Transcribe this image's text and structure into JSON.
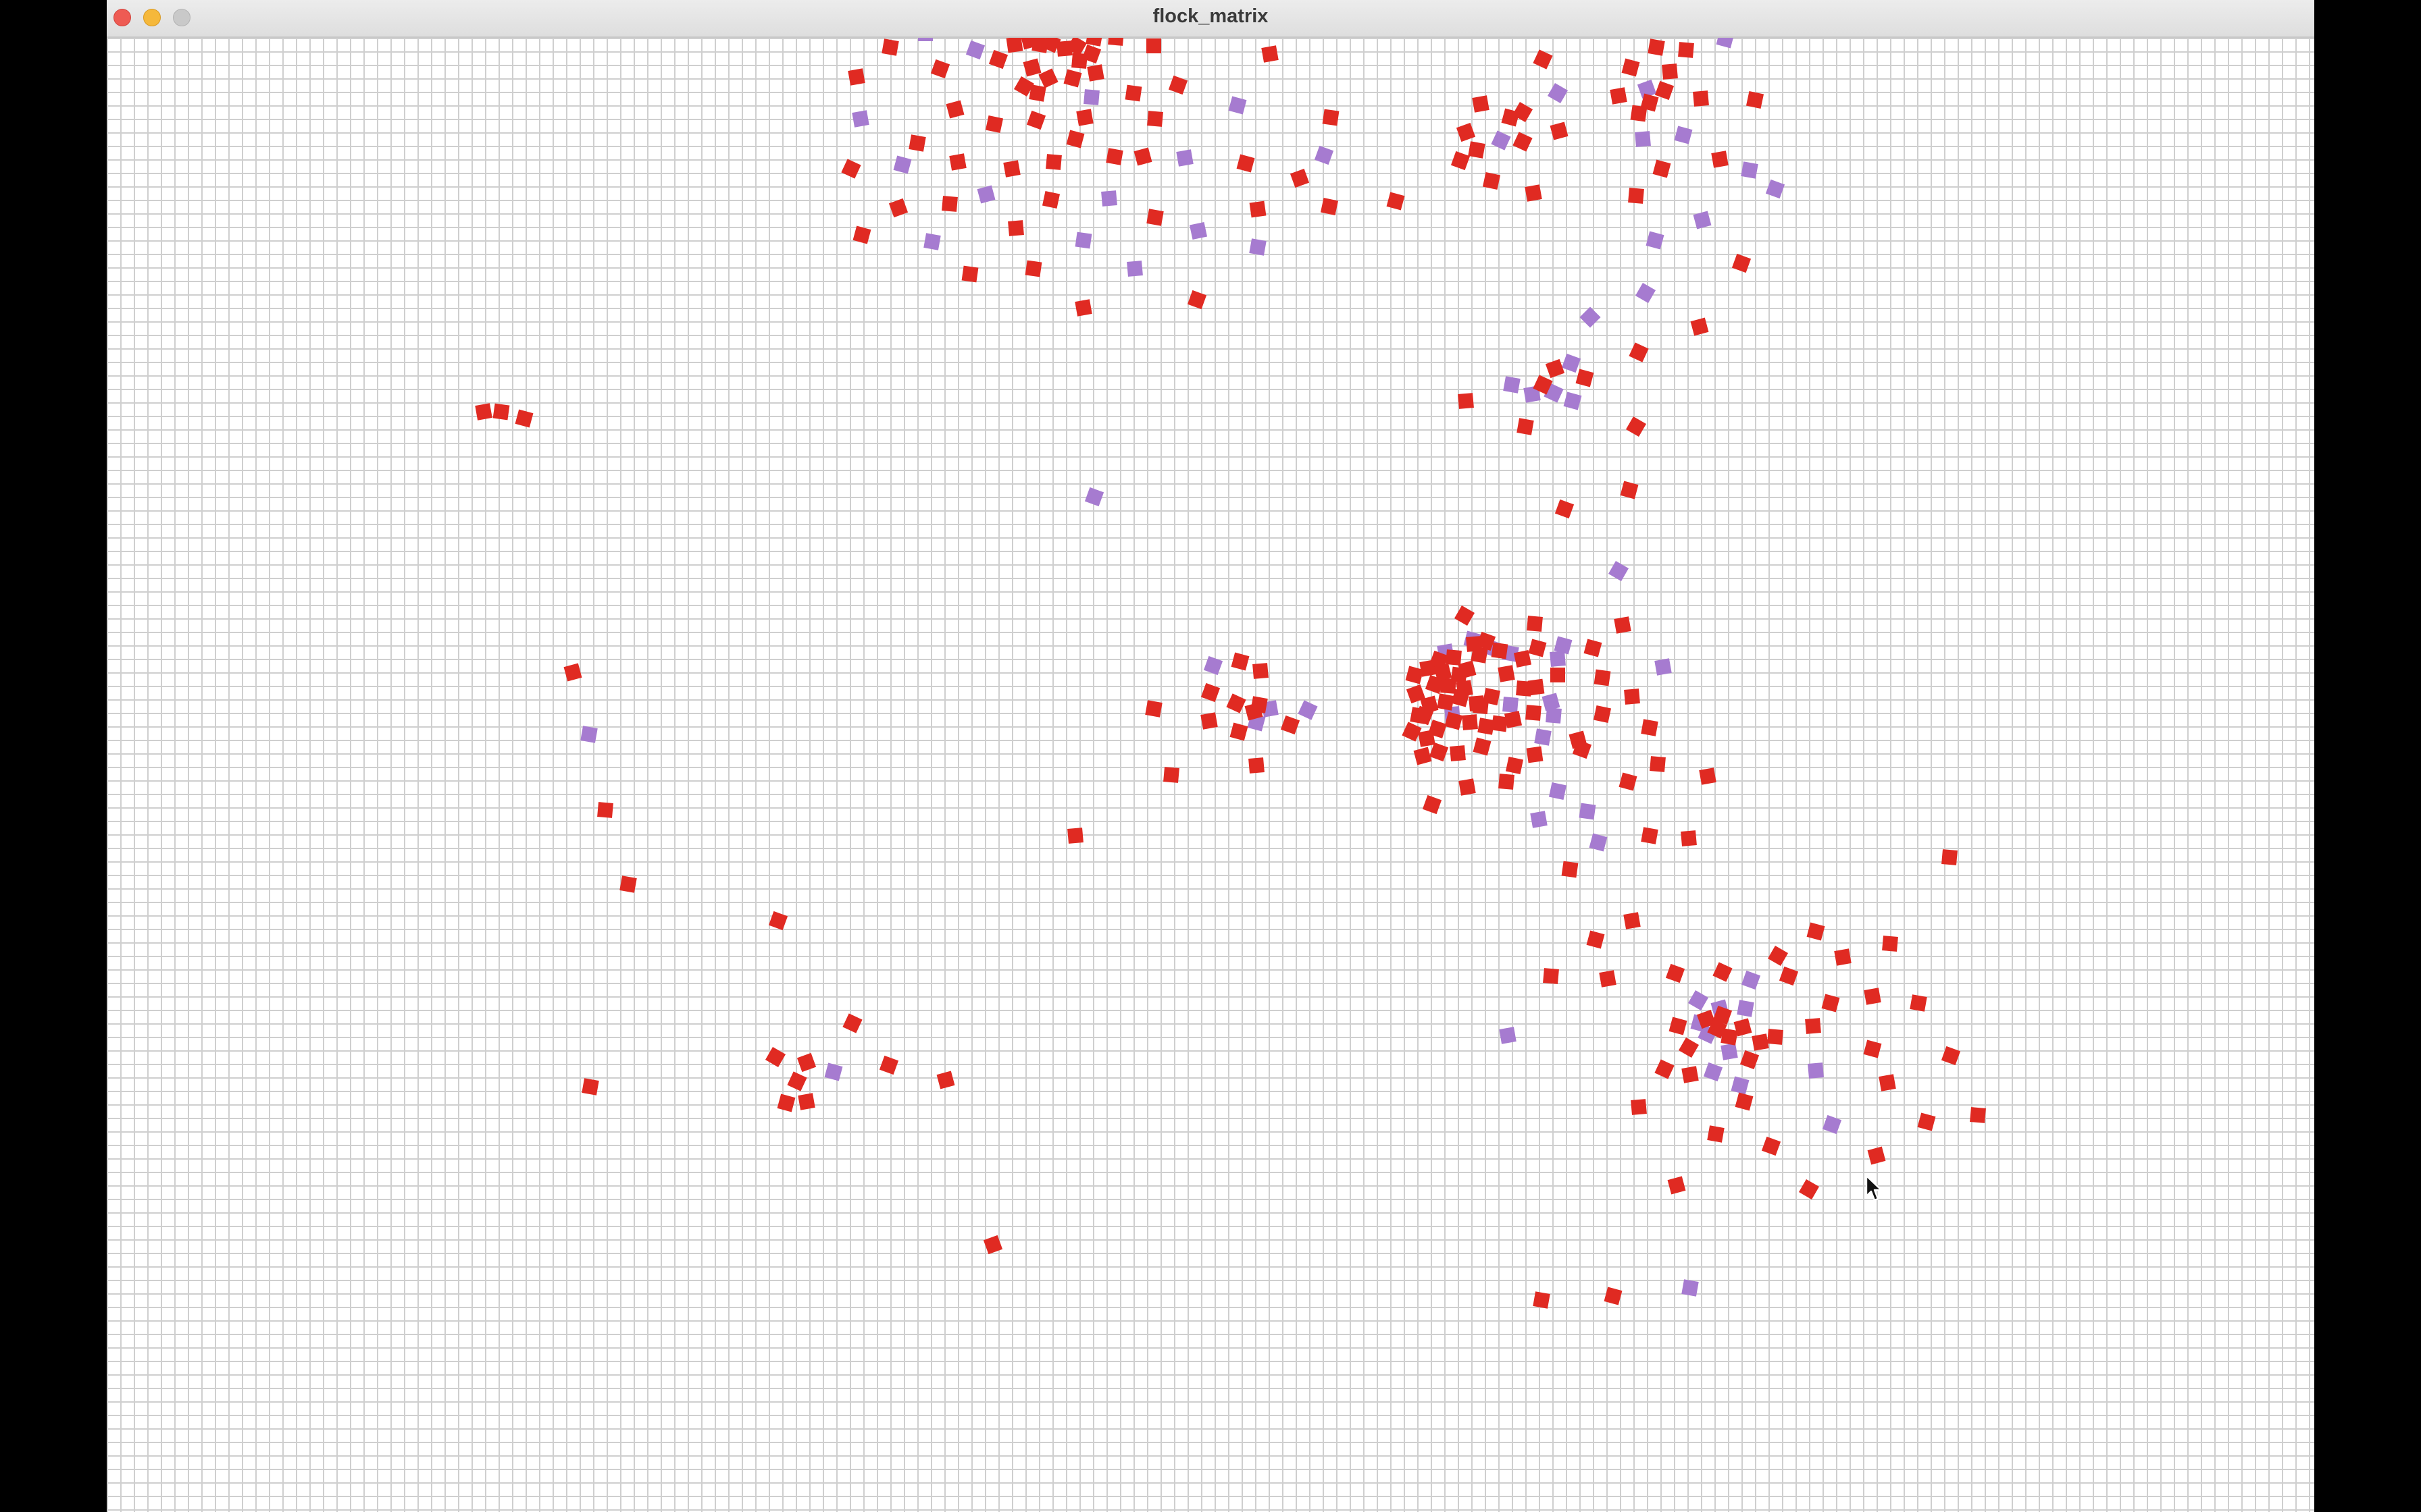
{
  "window": {
    "title": "flock_matrix"
  },
  "colors": {
    "red_boid": "#e02a22",
    "purple_boid": "#a67bd0",
    "grid_line": "#cfcfcf",
    "background": "#ffffff"
  },
  "canvas": {
    "grid": "on",
    "boid_shape": "square",
    "cursor_icon": "arrow-cursor-icon"
  }
}
